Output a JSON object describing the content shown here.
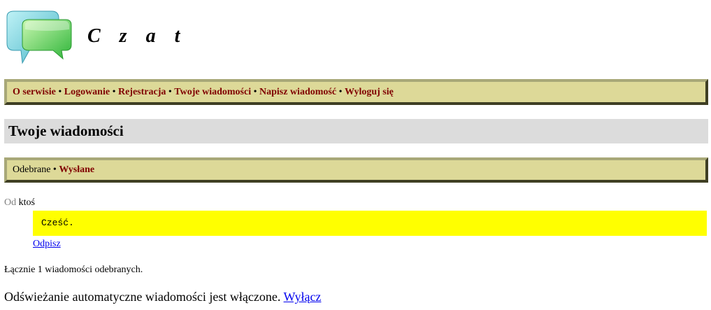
{
  "header": {
    "title": "C z a t",
    "logo_icon": "chat-bubbles-icon"
  },
  "nav": {
    "items": [
      "O serwisie",
      "Logowanie",
      "Rejestracja",
      "Twoje wiadomości",
      "Napisz wiadomość",
      "Wyloguj się"
    ],
    "separator": "•"
  },
  "page": {
    "heading": "Twoje wiadomości"
  },
  "tabs": {
    "received": "Odebrane",
    "separator": "•",
    "sent": "Wysłane"
  },
  "message": {
    "from_label": "Od",
    "from_user": "ktoś",
    "body": "Cześć.",
    "reply_label": "Odpisz"
  },
  "summary": "Łącznie 1 wiadomości odebranych.",
  "refresh": {
    "text": "Odświeżanie automatyczne wiadomości jest włączone.",
    "toggle_label": "Wyłącz"
  },
  "colors": {
    "nav_background": "#ddd998",
    "nav_link": "#800000",
    "heading_background": "#dcdcdc",
    "message_background": "#ffff00"
  }
}
